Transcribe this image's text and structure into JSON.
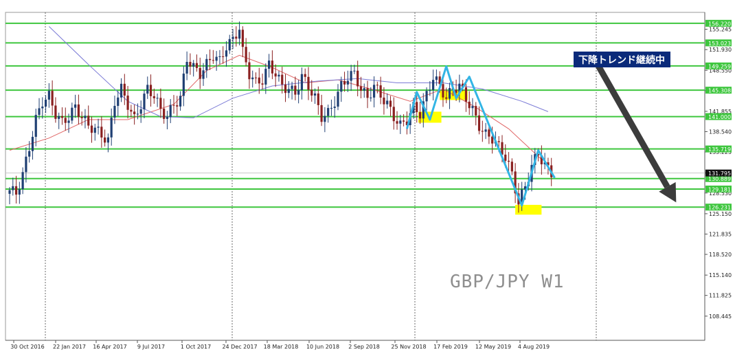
{
  "chart_data": {
    "type": "candlestick",
    "symbol": "GBP/JPY W1",
    "ylim": [
      104.5,
      158.0
    ],
    "x_ticks": [
      "30 Oct 2016",
      "22 Jan 2017",
      "16 Apr 2017",
      "9 Jul 2017",
      "1 Oct 2017",
      "24 Dec 2017",
      "18 Mar 2018",
      "10 Jun 2018",
      "2 Sep 2018",
      "25 Nov 2018",
      "17 Feb 2019",
      "12 May 2019",
      "4 Aug 2019"
    ],
    "y_ticks": [
      "155.245",
      "151.930",
      "148.550",
      "145.235",
      "141.855",
      "138.540",
      "135.225",
      "131.795",
      "128.530",
      "125.150",
      "121.835",
      "118.520",
      "115.140",
      "111.825",
      "108.445"
    ],
    "horizontal_levels": [
      {
        "label": "156.220",
        "value": 156.22
      },
      {
        "label": "153.023",
        "value": 153.023
      },
      {
        "label": "149.259",
        "value": 149.259
      },
      {
        "label": "145.308",
        "value": 145.308
      },
      {
        "label": "141.000",
        "value": 141.0
      },
      {
        "label": "135.719",
        "value": 135.719
      },
      {
        "label": "130.889",
        "value": 130.889
      },
      {
        "label": "129.181",
        "value": 129.181
      },
      {
        "label": "126.231",
        "value": 126.231
      }
    ],
    "current_price": {
      "label": "131.795",
      "value": 131.795
    },
    "annotation": "下降トレンド継続中",
    "approx_weekly_close_path": [
      {
        "x": 0,
        "y": 129.0
      },
      {
        "x": 2,
        "y": 128.5
      },
      {
        "x": 4,
        "y": 131.5
      },
      {
        "x": 6,
        "y": 136.0
      },
      {
        "x": 8,
        "y": 140.5
      },
      {
        "x": 10,
        "y": 143.5
      },
      {
        "x": 12,
        "y": 144.3
      },
      {
        "x": 14,
        "y": 141.5
      },
      {
        "x": 16,
        "y": 140.0
      },
      {
        "x": 18,
        "y": 141.0
      },
      {
        "x": 20,
        "y": 142.5
      },
      {
        "x": 22,
        "y": 141.0
      },
      {
        "x": 24,
        "y": 139.5
      },
      {
        "x": 26,
        "y": 139.0
      },
      {
        "x": 28,
        "y": 138.0
      },
      {
        "x": 30,
        "y": 137.0
      },
      {
        "x": 32,
        "y": 143.5
      },
      {
        "x": 34,
        "y": 145.5
      },
      {
        "x": 36,
        "y": 143.0
      },
      {
        "x": 38,
        "y": 140.5
      },
      {
        "x": 40,
        "y": 143.0
      },
      {
        "x": 42,
        "y": 145.5
      },
      {
        "x": 44,
        "y": 144.5
      },
      {
        "x": 46,
        "y": 142.0
      },
      {
        "x": 48,
        "y": 141.0
      },
      {
        "x": 50,
        "y": 143.0
      },
      {
        "x": 52,
        "y": 144.0
      },
      {
        "x": 54,
        "y": 150.5
      },
      {
        "x": 56,
        "y": 149.0
      },
      {
        "x": 58,
        "y": 148.0
      },
      {
        "x": 60,
        "y": 149.5
      },
      {
        "x": 62,
        "y": 151.0
      },
      {
        "x": 64,
        "y": 150.0
      },
      {
        "x": 66,
        "y": 152.5
      },
      {
        "x": 68,
        "y": 153.5
      },
      {
        "x": 70,
        "y": 155.5
      },
      {
        "x": 71,
        "y": 151.5
      },
      {
        "x": 73,
        "y": 148.0
      },
      {
        "x": 75,
        "y": 146.5
      },
      {
        "x": 77,
        "y": 147.0
      },
      {
        "x": 79,
        "y": 149.5
      },
      {
        "x": 81,
        "y": 148.0
      },
      {
        "x": 83,
        "y": 146.0
      },
      {
        "x": 85,
        "y": 145.5
      },
      {
        "x": 87,
        "y": 144.8
      },
      {
        "x": 89,
        "y": 147.5
      },
      {
        "x": 91,
        "y": 146.0
      },
      {
        "x": 93,
        "y": 144.0
      },
      {
        "x": 95,
        "y": 141.0
      },
      {
        "x": 97,
        "y": 141.5
      },
      {
        "x": 99,
        "y": 143.5
      },
      {
        "x": 101,
        "y": 146.0
      },
      {
        "x": 103,
        "y": 147.5
      },
      {
        "x": 105,
        "y": 148.0
      },
      {
        "x": 107,
        "y": 145.5
      },
      {
        "x": 109,
        "y": 144.0
      },
      {
        "x": 111,
        "y": 146.0
      },
      {
        "x": 113,
        "y": 144.5
      },
      {
        "x": 115,
        "y": 143.0
      },
      {
        "x": 117,
        "y": 141.0
      },
      {
        "x": 119,
        "y": 139.5
      },
      {
        "x": 121,
        "y": 140.5
      },
      {
        "x": 123,
        "y": 142.5
      },
      {
        "x": 125,
        "y": 141.5
      },
      {
        "x": 127,
        "y": 144.5
      },
      {
        "x": 129,
        "y": 147.5
      },
      {
        "x": 131,
        "y": 146.0
      },
      {
        "x": 133,
        "y": 144.0
      },
      {
        "x": 135,
        "y": 145.5
      },
      {
        "x": 137,
        "y": 146.0
      },
      {
        "x": 139,
        "y": 144.0
      },
      {
        "x": 141,
        "y": 142.0
      },
      {
        "x": 143,
        "y": 139.5
      },
      {
        "x": 145,
        "y": 138.0
      },
      {
        "x": 147,
        "y": 137.5
      },
      {
        "x": 149,
        "y": 136.0
      },
      {
        "x": 151,
        "y": 134.5
      },
      {
        "x": 153,
        "y": 131.5
      },
      {
        "x": 155,
        "y": 127.0
      },
      {
        "x": 157,
        "y": 129.5
      },
      {
        "x": 159,
        "y": 133.0
      },
      {
        "x": 161,
        "y": 135.0
      },
      {
        "x": 163,
        "y": 133.0
      },
      {
        "x": 165,
        "y": 131.8
      }
    ],
    "moving_averages": [
      {
        "color": "#e06666",
        "points": [
          {
            "x": 0,
            "y": 135.5
          },
          {
            "x": 12,
            "y": 137.5
          },
          {
            "x": 24,
            "y": 140.5
          },
          {
            "x": 36,
            "y": 140.5
          },
          {
            "x": 50,
            "y": 143.0
          },
          {
            "x": 60,
            "y": 148.5
          },
          {
            "x": 70,
            "y": 151.0
          },
          {
            "x": 80,
            "y": 149.0
          },
          {
            "x": 90,
            "y": 146.5
          },
          {
            "x": 100,
            "y": 147.0
          },
          {
            "x": 110,
            "y": 145.5
          },
          {
            "x": 122,
            "y": 143.5
          },
          {
            "x": 132,
            "y": 145.5
          },
          {
            "x": 142,
            "y": 142.5
          },
          {
            "x": 152,
            "y": 139.0
          },
          {
            "x": 162,
            "y": 134.0
          }
        ]
      },
      {
        "color": "#7b7bd6",
        "points": [
          {
            "x": 12,
            "y": 155.7
          },
          {
            "x": 24,
            "y": 149.5
          },
          {
            "x": 36,
            "y": 143.5
          },
          {
            "x": 46,
            "y": 141.0
          },
          {
            "x": 56,
            "y": 140.8
          },
          {
            "x": 68,
            "y": 144.0
          },
          {
            "x": 80,
            "y": 146.0
          },
          {
            "x": 94,
            "y": 146.8
          },
          {
            "x": 106,
            "y": 147.2
          },
          {
            "x": 118,
            "y": 146.5
          },
          {
            "x": 132,
            "y": 146.5
          },
          {
            "x": 144,
            "y": 145.5
          },
          {
            "x": 156,
            "y": 143.5
          },
          {
            "x": 164,
            "y": 141.8
          }
        ]
      }
    ],
    "pattern_lines": [
      {
        "points": [
          {
            "x": 121,
            "y": 139.0
          },
          {
            "x": 124,
            "y": 145.0
          },
          {
            "x": 128,
            "y": 140.5
          },
          {
            "x": 133,
            "y": 149.2
          },
          {
            "x": 136,
            "y": 144.0
          },
          {
            "x": 140,
            "y": 147.5
          },
          {
            "x": 156,
            "y": 126.5
          },
          {
            "x": 161,
            "y": 135.5
          },
          {
            "x": 166,
            "y": 131.0
          }
        ]
      }
    ],
    "highlight_boxes": [
      {
        "x0": 124.5,
        "x1": 131.5,
        "y0": 140.0,
        "y1": 141.8
      },
      {
        "x0": 131.0,
        "x1": 139.5,
        "y0": 143.7,
        "y1": 145.2
      },
      {
        "x0": 154.0,
        "x1": 162.0,
        "y0": 125.0,
        "y1": 126.6
      }
    ],
    "trend_arrow": {
      "from": {
        "x": 178,
        "y": 150.5
      },
      "to": {
        "x": 203,
        "y": 127.0
      }
    },
    "grid": false,
    "legend": "none"
  },
  "colors": {
    "level_line": "#3ec63e",
    "level_label_bg": "#3ec63e",
    "current_price_bg": "#111111",
    "up_candle": "#1f3f73",
    "down_candle": "#8a2020",
    "pattern_line": "#33b5e5",
    "highlight": "#ffff00",
    "trend_arrow": "#3c3c3c",
    "banner_bg": "#0a2a7a",
    "ma_fast": "#e06666",
    "ma_slow": "#7b7bd6"
  }
}
